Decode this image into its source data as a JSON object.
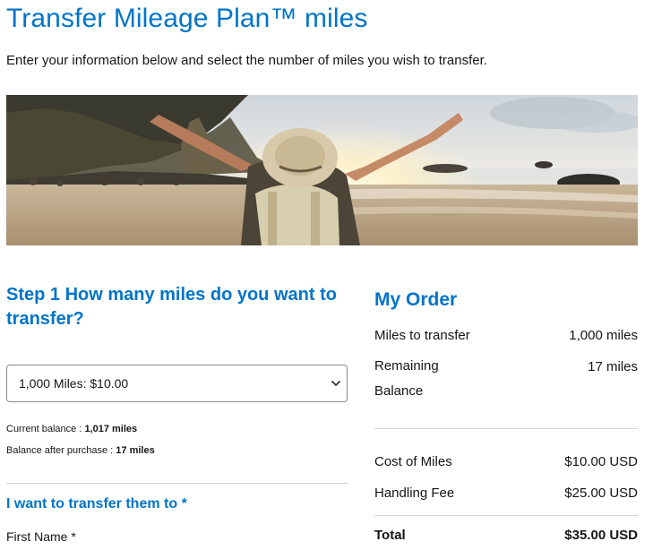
{
  "header": {
    "title": "Transfer Mileage Plan™ miles",
    "intro": "Enter your information below and select the number of miles you wish to transfer."
  },
  "hero": {
    "alt": "hero-beach-image"
  },
  "step1": {
    "title": "Step 1 How many miles do you want to transfer?",
    "select_value": "1,000 Miles: $10.00",
    "current_balance_label": "Current balance : ",
    "current_balance_value": "1,017 miles",
    "after_purchase_label": "Balance after purchase : ",
    "after_purchase_value": "17 miles"
  },
  "transfer": {
    "heading": "I want to transfer them to *",
    "first_name_label": "First Name *"
  },
  "order": {
    "title": "My Order",
    "miles_label": "Miles to transfer",
    "miles_value": "1,000 miles",
    "remaining_label": "Remaining Balance",
    "remaining_value": "17 miles",
    "cost_label": "Cost of Miles",
    "cost_value": "$10.00 USD",
    "fee_label": "Handling Fee",
    "fee_value": "$25.00 USD",
    "total_label": "Total",
    "total_value": "$35.00 USD"
  },
  "colors": {
    "brand_blue": "#0074c8",
    "text": "#151515",
    "divider": "#d4d4d4"
  }
}
